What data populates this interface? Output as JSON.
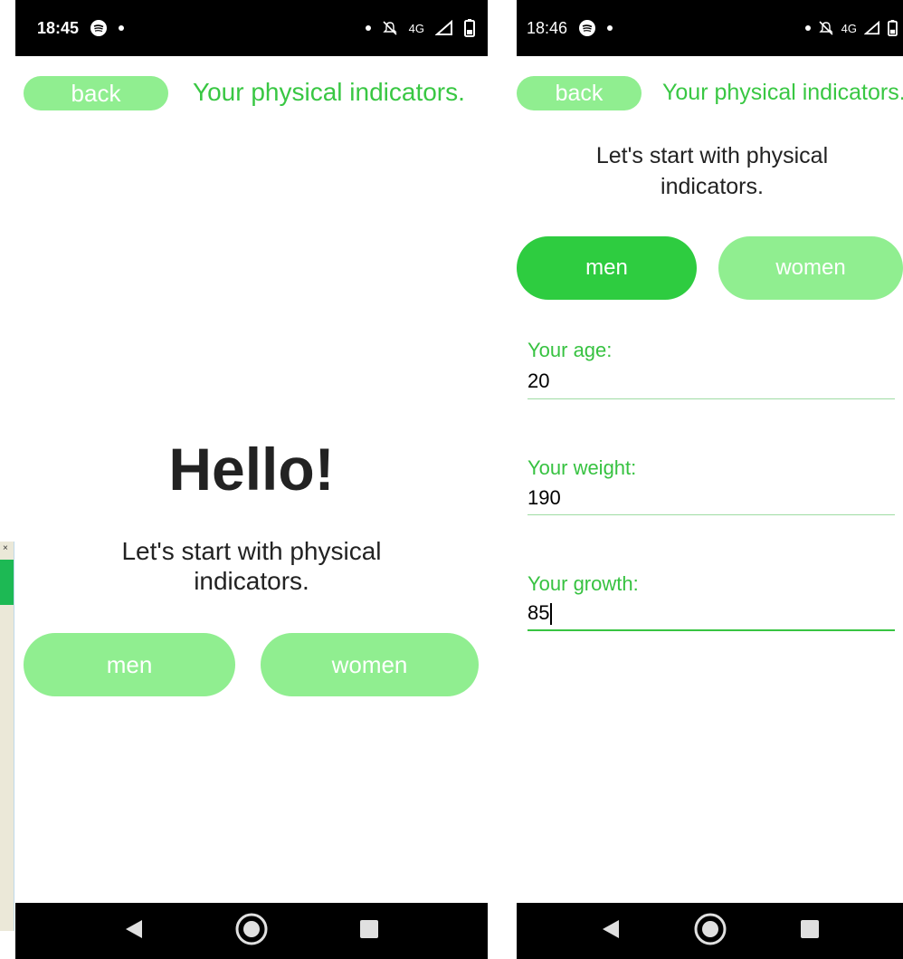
{
  "left_screen": {
    "status_bar": {
      "time": "18:45",
      "network": "4G"
    },
    "header": {
      "back_label": "back",
      "title": "Your physical indicators."
    },
    "greeting": "Hello!",
    "subtitle_line1": "Let's start with physical",
    "subtitle_line2": "indicators.",
    "gender_buttons": {
      "men_label": "men",
      "women_label": "women"
    }
  },
  "right_screen": {
    "status_bar": {
      "time": "18:46",
      "network": "4G"
    },
    "header": {
      "back_label": "back",
      "title": "Your physical indicators."
    },
    "subtitle_line1": "Let's start with physical",
    "subtitle_line2": "indicators.",
    "gender_buttons": {
      "men_label": "men",
      "women_label": "women",
      "selected": "men"
    },
    "fields": {
      "age": {
        "label": "Your age:",
        "value": "20"
      },
      "weight": {
        "label": "Your weight:",
        "value": "190"
      },
      "growth": {
        "label": "Your growth:",
        "value": "85"
      }
    }
  },
  "colors": {
    "pill_light": "#90ee90",
    "pill_selected": "#2ecc40",
    "title_green": "#39c743"
  },
  "icons": [
    "spotify-icon",
    "mute-icon",
    "signal-icon",
    "battery-icon",
    "nav-back-icon",
    "nav-home-icon",
    "nav-recents-icon",
    "close-icon"
  ]
}
